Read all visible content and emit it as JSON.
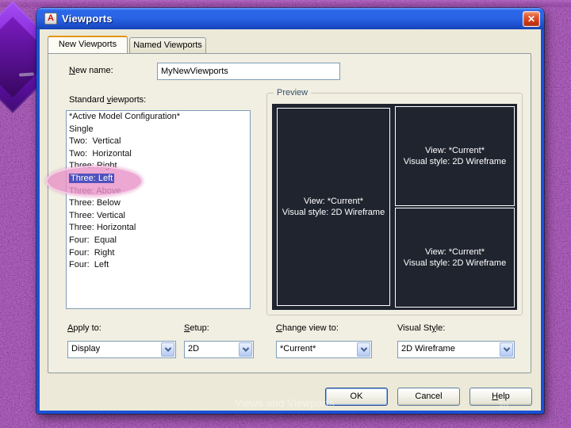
{
  "window": {
    "title": "Viewports",
    "close_glyph": "✕"
  },
  "icons": {
    "autocad_glyph": "A"
  },
  "tabs": [
    {
      "label": "New Viewports",
      "active": true
    },
    {
      "label": "Named Viewports",
      "active": false
    }
  ],
  "form": {
    "new_name_label": "&New name:",
    "new_name_value": "MyNewViewports",
    "standard_viewports_label": "Standard &viewports:",
    "apply_to_label": "&Apply to:",
    "apply_to_value": "Display",
    "setup_label": "&Setup:",
    "setup_value": "2D",
    "change_view_label": "&Change view to:",
    "change_view_value": "*Current*",
    "visual_style_label": "Visual St&yle:",
    "visual_style_value": "2D Wireframe"
  },
  "standard_viewports": {
    "selected_index": 5,
    "items": [
      "*Active Model Configuration*",
      "Single",
      "Two:  Vertical",
      "Two:  Horizontal",
      "Three: Right",
      "Three: Left",
      "Three: Above",
      "Three: Below",
      "Three: Vertical",
      "Three: Horizontal",
      "Four:  Equal",
      "Four:  Right",
      "Four:  Left"
    ]
  },
  "preview": {
    "group_label": "Preview",
    "panes": [
      {
        "view": "View: *Current*",
        "style": "Visual style: 2D Wireframe"
      },
      {
        "view": "View: *Current*",
        "style": "Visual style: 2D Wireframe"
      },
      {
        "view": "View: *Current*",
        "style": "Visual style: 2D Wireframe"
      }
    ]
  },
  "buttons": {
    "ok": "OK",
    "cancel": "Cancel",
    "help": "&Help"
  },
  "footer": {
    "text": "Views and Viewports",
    "page_number": "39"
  },
  "colors": {
    "titlebar_blue": "#2a65e6",
    "dialog_face": "#ece9d8",
    "selection_blue": "#4f51bd",
    "highlight_pink": "#e791c7",
    "preview_dark": "#20242f",
    "tab_accent_orange": "#e5940e",
    "close_red": "#cc3914"
  }
}
